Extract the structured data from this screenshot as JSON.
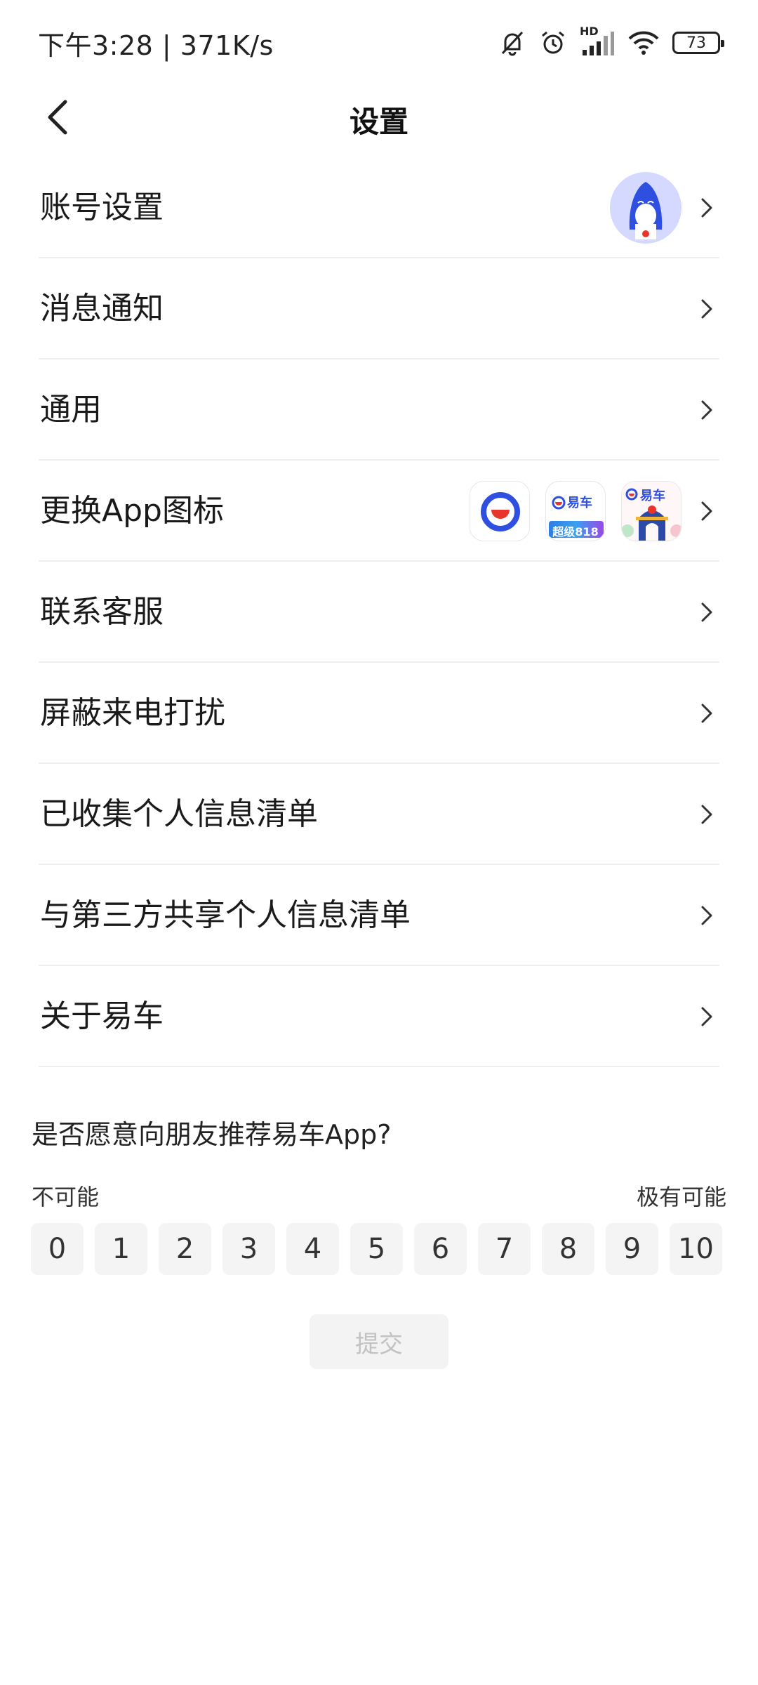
{
  "status_bar": {
    "time_speed": "下午3:28 | 371K/s",
    "battery": "73",
    "icons": [
      "mute-bell-icon",
      "alarm-icon",
      "hd-signal-icon",
      "wifi-icon",
      "battery-icon"
    ],
    "network_label": "HD"
  },
  "header": {
    "title": "设置",
    "back_icon": "chevron-left-icon"
  },
  "settings": {
    "items": [
      {
        "label": "账号设置",
        "extra": "avatar"
      },
      {
        "label": "消息通知"
      },
      {
        "label": "通用"
      },
      {
        "label": "更换App图标",
        "extra": "app-icons"
      },
      {
        "label": "联系客服"
      },
      {
        "label": "屏蔽来电打扰"
      },
      {
        "label": "已收集个人信息清单"
      },
      {
        "label": "与第三方共享个人信息清单"
      },
      {
        "label": "关于易车"
      }
    ],
    "app_icons": [
      {
        "name": "default-app-icon"
      },
      {
        "name": "super818-app-icon",
        "brand": "易车",
        "badge": "超级818"
      },
      {
        "name": "festival-app-icon",
        "brand": "易车"
      }
    ]
  },
  "survey": {
    "question": "是否愿意向朋友推荐易车App?",
    "low_label": "不可能",
    "high_label": "极有可能",
    "scores": [
      "0",
      "1",
      "2",
      "3",
      "4",
      "5",
      "6",
      "7",
      "8",
      "9",
      "10"
    ],
    "submit_label": "提交"
  },
  "colors": {
    "brand_blue": "#2f4fe0",
    "brand_red": "#e8352b",
    "divider": "#efefef",
    "score_bg": "#f4f4f4",
    "submit_text_disabled": "#c2c2c2"
  }
}
